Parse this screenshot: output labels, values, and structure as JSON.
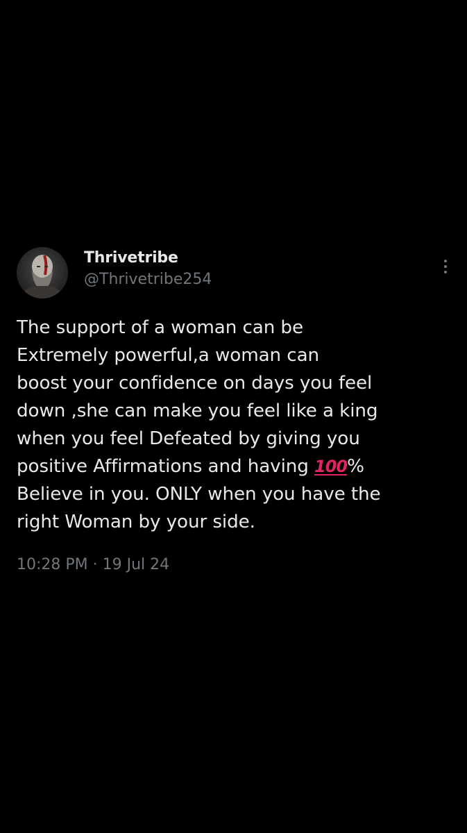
{
  "tweet": {
    "display_name": "Thrivetribe",
    "handle": "@Thrivetribe254",
    "text_lines": [
      "The support of a woman can be",
      "Extremely powerful,a woman can",
      "boost your confidence on days you feel",
      "down ,she can make you feel like a king",
      "when you feel Defeated by giving you",
      "positive Affirmations and having ",
      "Believe in you. ONLY when you have the",
      "right Woman by your side."
    ],
    "emoji_hundred": "💯",
    "emoji_hundred_text": "100",
    "percent": "%",
    "time": "10:28 PM",
    "separator": " · ",
    "date": "19 Jul 24",
    "more_icon": "more-vertical-icon",
    "avatar_icon": "avatar-image"
  },
  "colors": {
    "background": "#000000",
    "primary_text": "#e7e9ea",
    "secondary_text": "#71767b",
    "emoji_red": "#e0245e"
  }
}
